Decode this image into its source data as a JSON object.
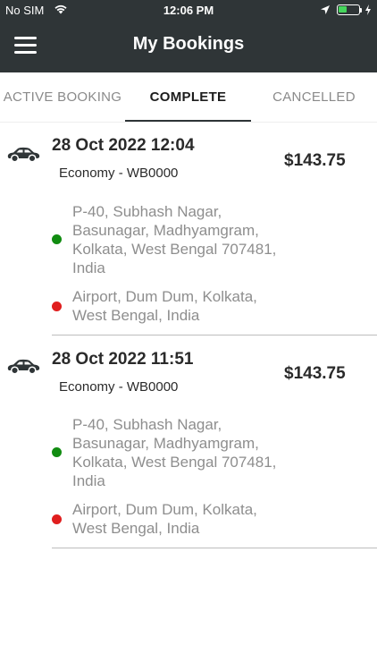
{
  "status_bar": {
    "carrier": "No SIM",
    "time": "12:06 PM",
    "battery_level": 0.45
  },
  "nav": {
    "title": "My Bookings"
  },
  "tabs": [
    {
      "label": "ACTIVE BOOKING",
      "active": false
    },
    {
      "label": "COMPLETE",
      "active": true
    },
    {
      "label": "CANCELLED",
      "active": false
    }
  ],
  "colors": {
    "header_bg": "#2f3537",
    "pickup_dot": "#118c11",
    "drop_dot": "#e01e1e",
    "battery": "#45d65c"
  },
  "bookings": [
    {
      "datetime": "28 Oct 2022 12:04",
      "price": "$143.75",
      "vehicle": "Economy - WB0000",
      "pickup": "P-40, Subhash Nagar, Basunagar, Madhyamgram, Kolkata, West Bengal 707481, India",
      "drop": "Airport, Dum Dum, Kolkata, West Bengal, India"
    },
    {
      "datetime": "28 Oct 2022 11:51",
      "price": "$143.75",
      "vehicle": "Economy - WB0000",
      "pickup": "P-40, Subhash Nagar, Basunagar, Madhyamgram, Kolkata, West Bengal 707481, India",
      "drop": "Airport, Dum Dum, Kolkata, West Bengal, India"
    }
  ]
}
